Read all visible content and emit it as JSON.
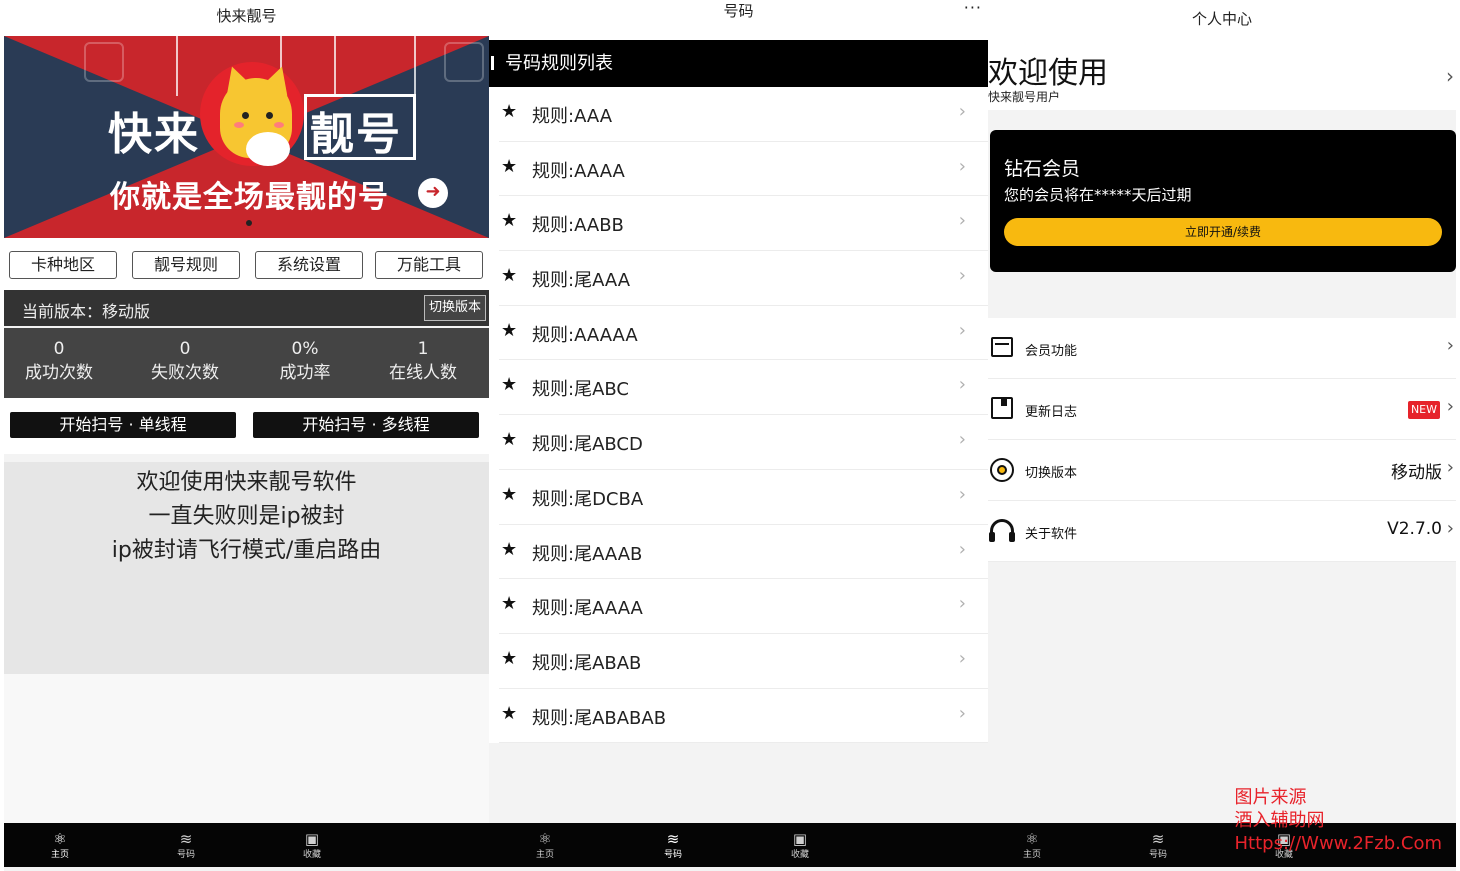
{
  "screens": {
    "home": {
      "title": "快来靓号",
      "banner": {
        "title_left": "快来",
        "title_right": "靓号",
        "slogan": "你就是全场最靓的号"
      },
      "nav_buttons": [
        "卡种地区",
        "靓号规则",
        "系统设置",
        "万能工具"
      ],
      "version_label": "当前版本：移动版",
      "switch_version": "切换版本",
      "stats": [
        {
          "value": "0",
          "label": "成功次数"
        },
        {
          "value": "0",
          "label": "失败次数"
        },
        {
          "value": "0%",
          "label": "成功率"
        },
        {
          "value": "1",
          "label": "在线人数"
        }
      ],
      "actions": [
        "开始扫号 · 单线程",
        "开始扫号 · 多线程"
      ],
      "notice": [
        "欢迎使用快来靓号软件",
        "一直失败则是ip被封",
        "ip被封请飞行模式/重启路由"
      ]
    },
    "rules": {
      "title": "号码",
      "more": "···",
      "header": "号码规则列表",
      "items": [
        "规则:AAA",
        "规则:AAAA",
        "规则:AABB",
        "规则:尾AAA",
        "规则:AAAAA",
        "规则:尾ABC",
        "规则:尾ABCD",
        "规则:尾DCBA",
        "规则:尾AAAB",
        "规则:尾AAAA",
        "规则:尾ABAB",
        "规则:尾ABABAB"
      ]
    },
    "profile": {
      "title": "个人中心",
      "welcome": "欢迎使用",
      "username": "快来靓号用户",
      "vip": {
        "title": "钻石会员",
        "subtitle": "您的会员将在*****天后过期",
        "button": "立即开通/续费"
      },
      "menu": [
        {
          "label": "会员功能",
          "value": ""
        },
        {
          "label": "更新日志",
          "value": "",
          "badge": "NEW"
        },
        {
          "label": "切换版本",
          "value": "移动版"
        },
        {
          "label": "关于软件",
          "value": "V2.7.0"
        }
      ]
    }
  },
  "tabbar": {
    "tabs": [
      {
        "label": "主页",
        "icon": "atom-icon"
      },
      {
        "label": "号码",
        "icon": "layers-icon"
      },
      {
        "label": "收藏",
        "icon": "bookmark-icon"
      }
    ]
  },
  "watermark": [
    "图片来源",
    "酒入辅助网",
    "Https://Www.2Fzb.Com"
  ],
  "colors": {
    "accent_red": "#c8262c",
    "vip_gold": "#f8b90f",
    "dark": "#000000",
    "badge_red": "#e6232b"
  }
}
